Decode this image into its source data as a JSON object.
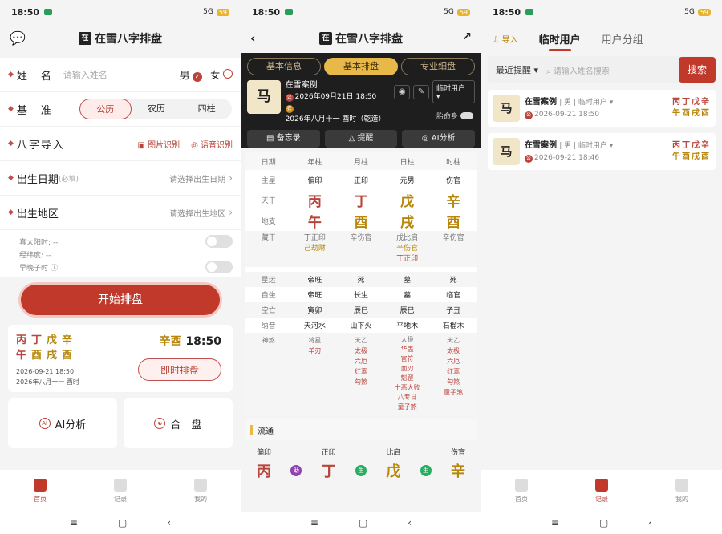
{
  "status": {
    "time": "18:50",
    "net1": "16.9\nKB/s",
    "net2": "5.65\nKB/s",
    "signal": "5G",
    "battery": "59"
  },
  "panel1": {
    "title": "在雪八字排盘",
    "name_label": "姓　名",
    "name_placeholder": "请输入姓名",
    "male": "男",
    "female": "女",
    "basis_label": "基　准",
    "basis_opts": [
      "公历",
      "农历",
      "四柱"
    ],
    "import_label": "八字导入",
    "img_recog": "图片识别",
    "voice_recog": "语音识别",
    "birthdate_label": "出生日期",
    "required": "(必填)",
    "birthdate_hint": "请选择出生日期",
    "birthplace_label": "出生地区",
    "birthplace_hint": "请选择出生地区",
    "solar_time": "真太阳时: --",
    "lonlat": "经纬度: --",
    "zaowan": "早晚子时",
    "start_btn": "开始排盘",
    "recent": {
      "stems": [
        "丙",
        "丁",
        "戊",
        "辛"
      ],
      "branches": [
        "午",
        "酉",
        "戌",
        "酉"
      ],
      "date1": "2026-09-21 18:50",
      "date2": "2026年八月十一 酉时",
      "big_gz": "辛酉",
      "big_time": "18:50",
      "btn": "即时排盘"
    },
    "ai_card": "AI分析",
    "hepan_card": "合　盘",
    "tabs": [
      "首页",
      "记录",
      "我的"
    ]
  },
  "panel2": {
    "title": "在雪八字排盘",
    "tabs": [
      "基本信息",
      "基本排盘",
      "专业细盘"
    ],
    "case_name": "在雪案例",
    "gong": "2026年09月21日 18:50",
    "nong": "2026年八月十一 酉时（乾造）",
    "user_dd": "临时用户",
    "taiming": "胎命身",
    "actions": [
      "备忘录",
      "提醒",
      "AI分析"
    ],
    "header": [
      "日期",
      "年柱",
      "月柱",
      "日柱",
      "时柱"
    ],
    "zhuxing": [
      "主星",
      "偏印",
      "正印",
      "元男",
      "伤官"
    ],
    "tiangan": [
      "天干",
      "丙",
      "丁",
      "戊",
      "辛"
    ],
    "dizhi": [
      "地支",
      "午",
      "酉",
      "戌",
      "酉"
    ],
    "canggan_label": "藏干",
    "canggan": [
      [
        "丁正印",
        "己劫财"
      ],
      [
        "辛伤官"
      ],
      [
        "戊比肩",
        "辛伤官",
        "丁正印"
      ],
      [
        "辛伤官"
      ]
    ],
    "xingyun": [
      "星运",
      "帝旺",
      "死",
      "墓",
      "死"
    ],
    "zizuo": [
      "自坐",
      "帝旺",
      "长生",
      "墓",
      "临官"
    ],
    "kongwang": [
      "空亡",
      "寅卯",
      "辰巳",
      "辰巳",
      "子丑"
    ],
    "nayin": [
      "纳音",
      "天河水",
      "山下火",
      "平地木",
      "石榴木"
    ],
    "shensha_label": "神煞",
    "shensha": [
      [
        "将星",
        "羊刃"
      ],
      [
        "天乙",
        "太极",
        "六厄",
        "红鸾",
        "勾煞"
      ],
      [
        "太极",
        "华盖",
        "官符",
        "血刃",
        "魁罡",
        "十恶大败",
        "八专日",
        "童子煞"
      ],
      [
        "天乙",
        "太极",
        "六厄",
        "红鸾",
        "勾煞",
        "童子煞"
      ]
    ],
    "liutong": "流通",
    "flow_labels": [
      "偏印",
      "正印",
      "比肩",
      "伤官"
    ],
    "flow_chars": [
      "丙",
      "丁",
      "戊",
      "辛"
    ],
    "flow_badges": [
      "助",
      "生",
      "生"
    ]
  },
  "panel3": {
    "import": "导入",
    "tab_temp": "临时用户",
    "tab_group": "用户分组",
    "sort": "最近提醒",
    "search_placeholder": "请输入姓名搜索",
    "search_btn": "搜索",
    "records": [
      {
        "name": "在雪案例",
        "sex": "男",
        "group": "临时用户",
        "date": "2026-09-21 18:50",
        "stems": "丙丁戊辛",
        "branches": "午酉戌酉"
      },
      {
        "name": "在雪案例",
        "sex": "男",
        "group": "临时用户",
        "date": "2026-09-21 18:46",
        "stems": "丙丁戊辛",
        "branches": "午酉戌酉"
      }
    ],
    "tabs": [
      "首页",
      "记录",
      "我的"
    ]
  },
  "colors": {
    "accent": "#c0392b",
    "gold": "#b8860b",
    "dark": "#1e1e1e"
  }
}
